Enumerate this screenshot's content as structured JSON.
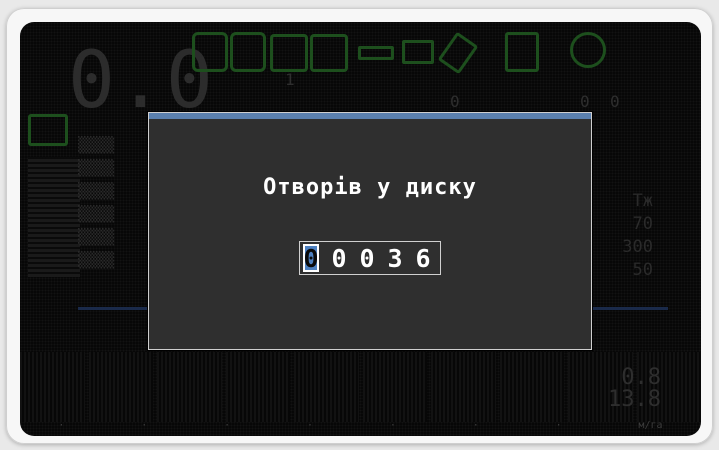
{
  "background": {
    "speed_display": "0.0",
    "counter_1": "1",
    "counter_2": "0",
    "counter_3": "0",
    "counter_4": "0",
    "values": [
      "Тж",
      "70",
      "300",
      "50"
    ],
    "bottom_value_1": "0.8",
    "bottom_value_2": "13.8",
    "footer_unit": "м/га"
  },
  "dialog": {
    "title": "Отворів у диску",
    "digits": [
      "0",
      "0",
      "0",
      "3",
      "6"
    ],
    "selected_index": 0
  },
  "colors": {
    "accent": "#5b80ae",
    "selection": "#4d80c0",
    "dialog_bg": "#2f2f2f",
    "screen_bg": "#050505"
  }
}
